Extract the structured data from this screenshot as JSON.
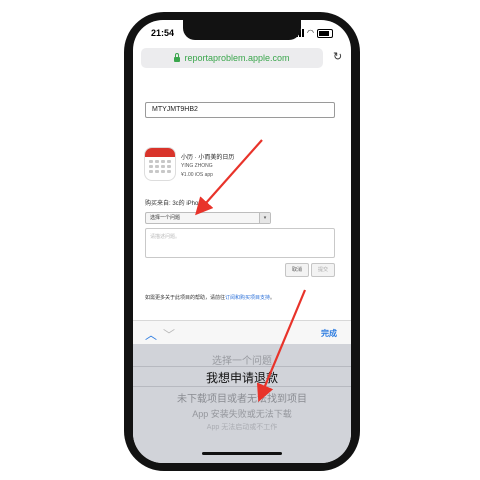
{
  "status_bar": {
    "time": "21:54"
  },
  "browser": {
    "url": "reportaproblem.apple.com"
  },
  "page": {
    "order_code": "MTYJMT9HB2",
    "app": {
      "name": "小历 · 小而美的日历",
      "developer": "YING ZHONG",
      "price": "¥1.00 iOS app"
    },
    "purchased_from": "购买来自: 3c的 iPhone",
    "select": {
      "value": "选择一个问题"
    },
    "textarea": {
      "placeholder": "请描述问题。"
    },
    "buttons": {
      "cancel": "取消",
      "submit": "提交"
    },
    "help": {
      "text": "如需更多关于此项目的帮助，请前往",
      "link": "订阅和购买项目支持",
      "end": "。"
    }
  },
  "keyboard_toolbar": {
    "done": "完成"
  },
  "picker": {
    "options": [
      "选择一个问题",
      "我想申请退款",
      "未下载项目或者无法找到项目",
      "App 安装失败或无法下载",
      "App 无法启动或不工作"
    ],
    "selected_index": 1
  },
  "colors": {
    "accent": "#2b7be0",
    "secure": "#3aa64c",
    "annotation": "#e8332a"
  }
}
